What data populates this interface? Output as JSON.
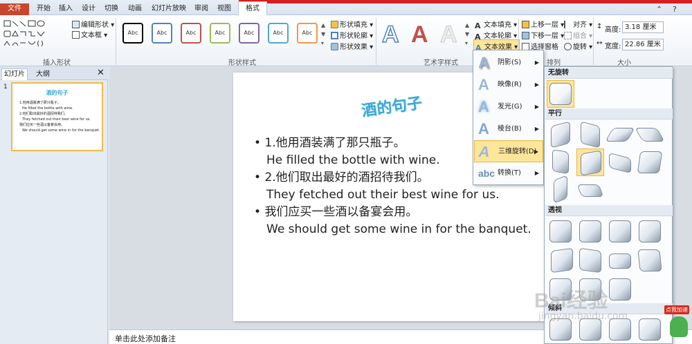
{
  "tabs": {
    "file": "文件",
    "items": [
      "开始",
      "插入",
      "设计",
      "切换",
      "动画",
      "幻灯片放映",
      "审阅",
      "视图"
    ],
    "active": "格式"
  },
  "ribbon": {
    "insert_shapes": {
      "label": "插入形状",
      "edit_shape": "编辑形状",
      "text_box": "文本框"
    },
    "shape_styles": {
      "label": "形状样式",
      "items": [
        {
          "text": "Abc",
          "color": "#000000"
        },
        {
          "text": "Abc",
          "color": "#4f81bd"
        },
        {
          "text": "Abc",
          "color": "#c0504d"
        },
        {
          "text": "Abc",
          "color": "#9bbb59"
        },
        {
          "text": "Abc",
          "color": "#8064a2"
        },
        {
          "text": "Abc",
          "color": "#4bacc6"
        },
        {
          "text": "Abc",
          "color": "#f79646"
        }
      ],
      "fill": "形状填充",
      "outline": "形状轮廓",
      "effects": "形状效果"
    },
    "wordart": {
      "label": "艺术字样式",
      "letters": [
        {
          "text": "A",
          "color": "#4f81bd"
        },
        {
          "text": "A",
          "color": "#c0504d"
        },
        {
          "text": "A",
          "color": "#d9d9d9"
        }
      ],
      "text_fill": "文本填充",
      "text_outline": "文本轮廓",
      "text_effects": "文本效果"
    },
    "arrange": {
      "label": "排列",
      "bring_forward": "上移一层",
      "send_backward": "下移一层",
      "selection_pane": "选择窗格",
      "align": "对齐",
      "group": "组合",
      "rotate": "旋转"
    },
    "size": {
      "label": "大小",
      "height_label": "高度:",
      "height": "3.18 厘米",
      "width_label": "宽度:",
      "width": "22.86 厘米"
    }
  },
  "left_panel": {
    "tab_slides": "幻灯片",
    "tab_outline": "大纲",
    "slide_number": "1",
    "thumb_title": "酒的句子",
    "thumb_lines": [
      "1.他用酒装满了那只瓶子。",
      "He filled the bottle with wine.",
      "2.他们取出最好的酒招待我们。",
      "They fetched out their best wine for us.",
      "我们应买一些酒以备宴会用。",
      "We should get some wine in for the banquet."
    ]
  },
  "slide": {
    "title": "酒的句子",
    "bullets": [
      {
        "cn": "1.他用酒装满了那只瓶子。",
        "en": "He filled the bottle with wine."
      },
      {
        "cn": "2.他们取出最好的酒招待我们。",
        "en": "They fetched out their best wine for us."
      },
      {
        "cn": "我们应买一些酒以备宴会用。",
        "en": "We should get some wine in for the banquet."
      }
    ]
  },
  "notes": "单击此处添加备注",
  "text_effects_menu": [
    {
      "label": "阴影(S)",
      "icon": "shadow-icon"
    },
    {
      "label": "映像(R)",
      "icon": "reflection-icon"
    },
    {
      "label": "发光(G)",
      "icon": "glow-icon"
    },
    {
      "label": "棱台(B)",
      "icon": "bevel-icon"
    },
    {
      "label": "三维旋转(D)",
      "icon": "3d-rotation-icon"
    },
    {
      "label": "转换(T)",
      "icon": "transform-icon"
    }
  ],
  "rotation_panel": {
    "no_rotation": "无旋转",
    "parallel": "平行",
    "perspective": "透视",
    "oblique": "倾斜"
  },
  "watermark": {
    "brand": "Bai经验",
    "url": "jingyan.baidu.com",
    "badge": "点我加速"
  },
  "colors": {
    "file_tab": "#c9452d",
    "accent_title": "#3aa7d8",
    "highlight": "#fde59a"
  }
}
